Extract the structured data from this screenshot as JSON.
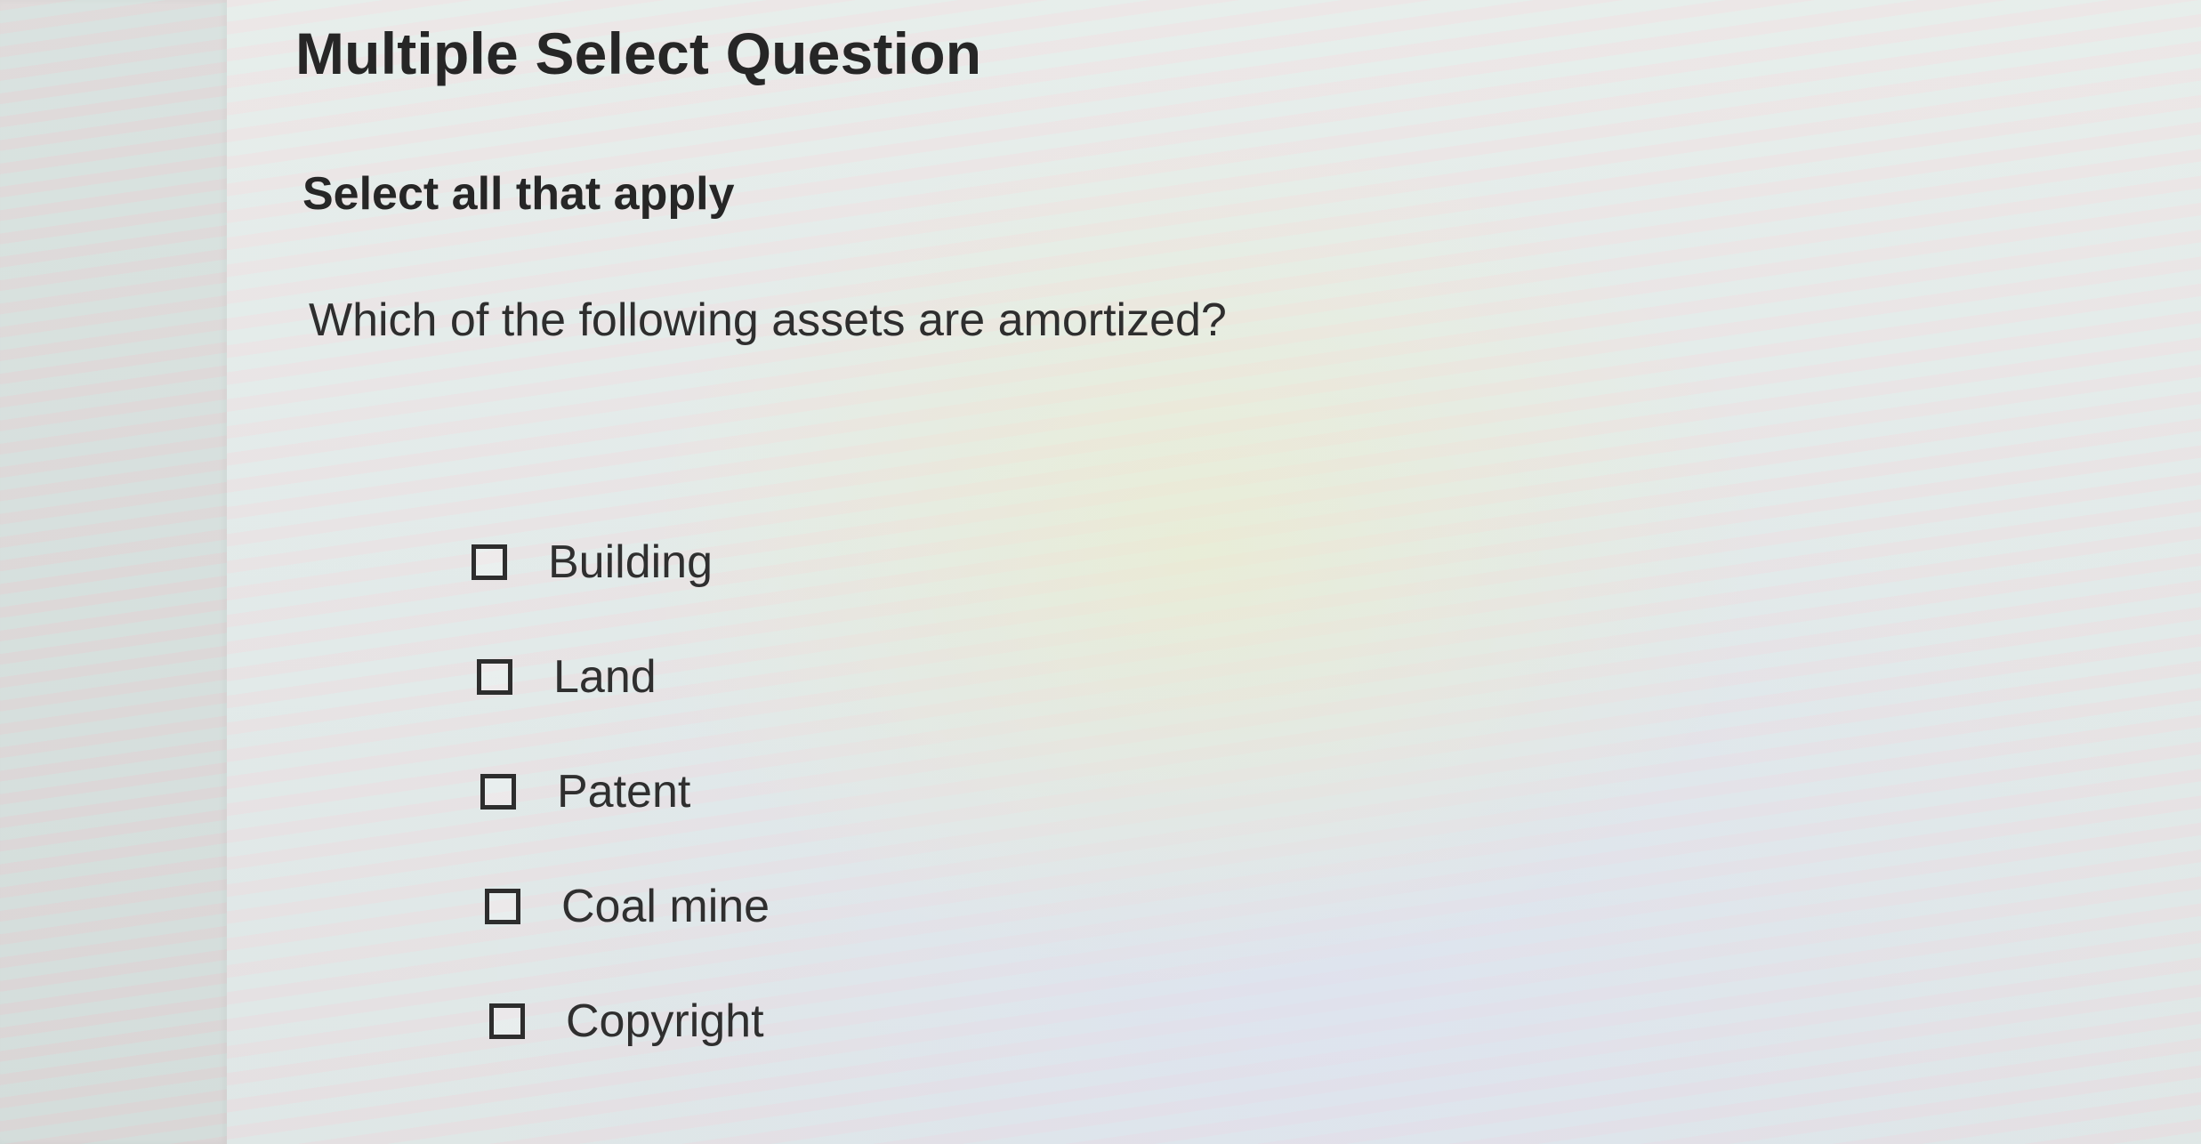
{
  "header": {
    "title": "Multiple Select Question"
  },
  "instruction": "Select all that apply",
  "question": "Which of the following assets are amortized?",
  "options": [
    {
      "label": "Building",
      "checked": false
    },
    {
      "label": "Land",
      "checked": false
    },
    {
      "label": "Patent",
      "checked": false
    },
    {
      "label": "Coal mine",
      "checked": false
    },
    {
      "label": "Copyright",
      "checked": false
    }
  ]
}
